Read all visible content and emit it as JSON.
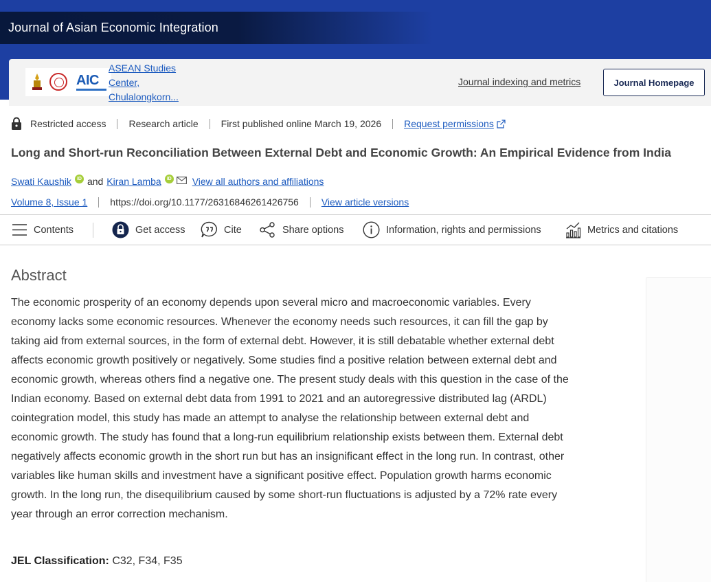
{
  "journal": {
    "title": "Journal of Asian Economic Integration"
  },
  "publisher": {
    "logo_text": "AIC",
    "link_lines": [
      "ASEAN Studies",
      "Center,",
      "Chulalongkorn..."
    ]
  },
  "header_links": {
    "indexing": "Journal indexing and metrics",
    "homepage_button": "Journal Homepage"
  },
  "meta": {
    "access": "Restricted access",
    "type": "Research article",
    "published": "First published online March 19, 2026",
    "permissions": "Request permissions"
  },
  "article": {
    "title": "Long and Short-run Reconciliation Between External Debt and Economic Growth: An Empirical Evidence from India"
  },
  "authors": {
    "author1": "Swati Kaushik",
    "conjunction": "and",
    "author2": "Kiran Lamba",
    "orcid_badge": "iD",
    "all_link": "View all authors and affiliations"
  },
  "citation": {
    "volume": "Volume 8, Issue 1",
    "doi": "https://doi.org/10.1177/26316846261426756",
    "versions": "View article versions"
  },
  "toolbar": {
    "contents": "Contents",
    "get_access": "Get access",
    "cite": "Cite",
    "share": "Share options",
    "info": "Information, rights and permissions",
    "metrics": "Metrics and citations"
  },
  "abstract": {
    "heading": "Abstract",
    "text": "The economic prosperity of an economy depends upon several micro and macroeconomic variables. Every economy lacks some economic resources. Whenever the economy needs such resources, it can fill the gap by taking aid from external sources, in the form of external debt. However, it is still debatable whether external debt affects economic growth positively or negatively. Some studies find a positive relation between external debt and economic growth, whereas others find a negative one. The present study deals with this question in the case of the Indian economy. Based on external debt data from 1991 to 2021 and an autoregressive distributed lag (ARDL) cointegration model, this study has made an attempt to analyse the relationship between external debt and economic growth. The study has found that a long-run equilibrium relationship exists between them. External debt negatively affects economic growth in the short run but has an insignificant effect in the long run. In contrast, other variables like human skills and investment have a significant positive effect. Population growth harms economic growth. In the long run, the disequilibrium caused by some short-run fluctuations is adjusted by a 72% rate every year through an error correction mechanism.",
    "jel_label": "JEL Classification:",
    "jel_codes": "C32, F34, F35"
  },
  "colors": {
    "brand_blue": "#1d3fa2",
    "title_bar": "#0a1a42",
    "link": "#1d5bbf",
    "orcid": "#a6ce39"
  }
}
